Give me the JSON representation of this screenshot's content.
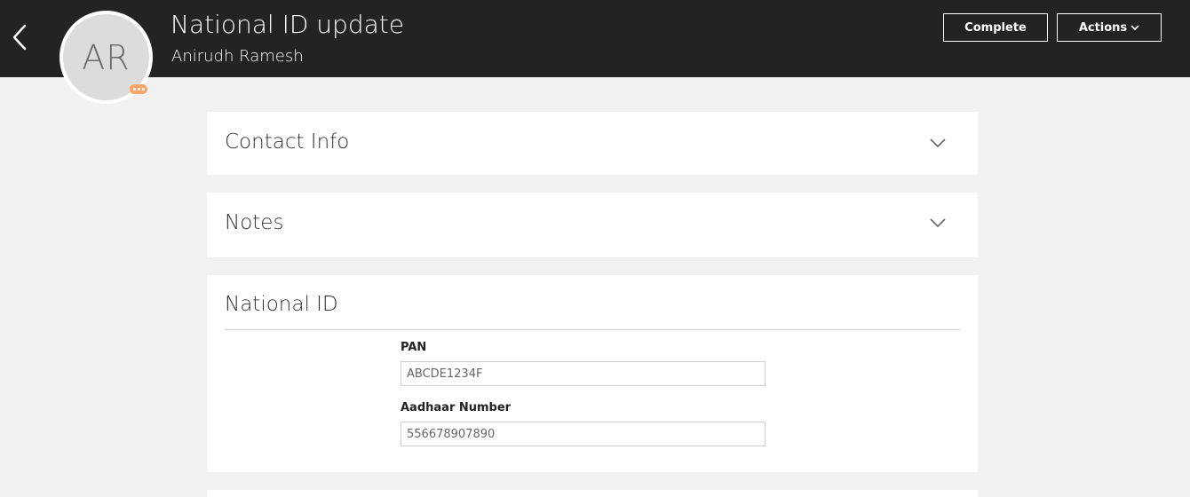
{
  "header": {
    "avatar_initials": "AR",
    "title": "National ID update",
    "subtitle": "Anirudh Ramesh",
    "complete_label": "Complete",
    "actions_label": "Actions"
  },
  "sections": {
    "contact_info": {
      "title": "Contact Info",
      "expanded": false
    },
    "notes": {
      "title": "Notes",
      "expanded": false
    },
    "national_id": {
      "title": "National ID",
      "expanded": true,
      "pan_label": "PAN",
      "pan_value": "ABCDE1234F",
      "aadhaar_label": "Aadhaar Number",
      "aadhaar_value": "556678907890"
    }
  },
  "colors": {
    "header_bg": "#232323",
    "page_bg": "#f1f1f1",
    "presence_badge": "#f7a56b"
  },
  "icons": {
    "back": "chevron-left-icon",
    "expand": "chevron-down-icon",
    "presence": "more-icon"
  }
}
